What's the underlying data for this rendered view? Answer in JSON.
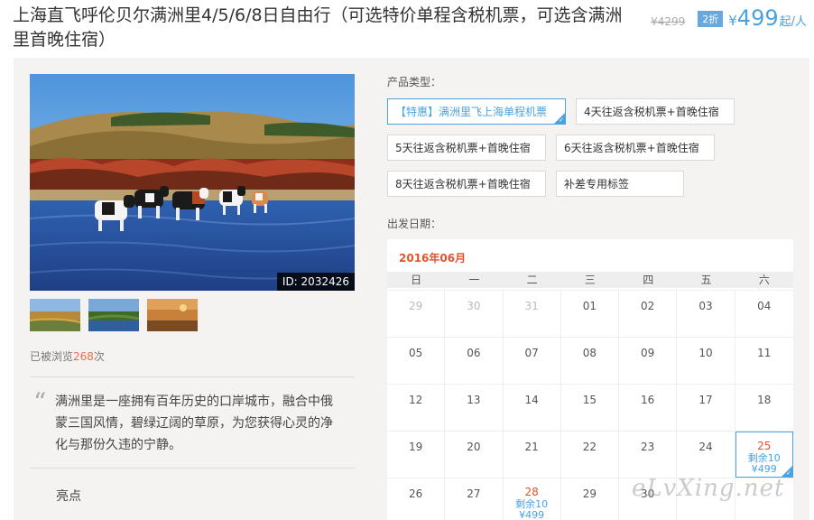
{
  "product": {
    "title": "上海直飞呼伦贝尔满洲里4/5/6/8日自由行（可选特价单程含税机票，可选含满洲里首晚住宿）",
    "old_price": "¥4299",
    "discount": "2折",
    "price_symbol": "¥",
    "price": "499",
    "price_unit": "起/人"
  },
  "gallery": {
    "image_id": "ID: 2032426",
    "views_prefix": "已被浏览",
    "views_count": "268",
    "views_suffix": "次"
  },
  "description": {
    "quote": "“",
    "text": "满洲里是一座拥有百年历史的口岸城市，融合中俄蒙三国风情，碧绿辽阔的草原，为您获得心灵的净化与那份久违的宁静。",
    "highlights_title": "亮点"
  },
  "options": {
    "product_type_label": "产品类型：",
    "product_types": [
      "【特惠】满洲里飞上海单程机票",
      "4天往返含税机票+首晚住宿",
      "5天往返含税机票+首晚住宿",
      "6天往返含税机票+首晚住宿",
      "8天往返含税机票+首晚住宿",
      "补差专用标签"
    ],
    "selected_type_index": 0,
    "departure_label": "出发日期："
  },
  "calendar": {
    "month": "2016年06月",
    "weekdays": [
      "日",
      "一",
      "二",
      "三",
      "四",
      "五",
      "六"
    ],
    "rows": [
      [
        {
          "d": "29",
          "m": true
        },
        {
          "d": "30",
          "m": true
        },
        {
          "d": "31",
          "m": true
        },
        {
          "d": "01"
        },
        {
          "d": "02"
        },
        {
          "d": "03"
        },
        {
          "d": "04"
        }
      ],
      [
        {
          "d": "05"
        },
        {
          "d": "06"
        },
        {
          "d": "07"
        },
        {
          "d": "08"
        },
        {
          "d": "09"
        },
        {
          "d": "10"
        },
        {
          "d": "11"
        }
      ],
      [
        {
          "d": "12"
        },
        {
          "d": "13"
        },
        {
          "d": "14"
        },
        {
          "d": "15"
        },
        {
          "d": "16"
        },
        {
          "d": "17"
        },
        {
          "d": "18"
        }
      ],
      [
        {
          "d": "19"
        },
        {
          "d": "20"
        },
        {
          "d": "21"
        },
        {
          "d": "22"
        },
        {
          "d": "23"
        },
        {
          "d": "24"
        },
        {
          "d": "25",
          "avail": true,
          "selected": true,
          "stock": "剩余10",
          "price": "¥499"
        }
      ],
      [
        {
          "d": "26"
        },
        {
          "d": "27"
        },
        {
          "d": "28",
          "avail": true,
          "stock": "剩余10",
          "price": "¥499"
        },
        {
          "d": "29"
        },
        {
          "d": "30"
        },
        {
          "d": ""
        },
        {
          "d": ""
        }
      ]
    ]
  },
  "watermark": "eLvXing.net",
  "colors": {
    "accent": "#4aa3df",
    "highlight": "#e0532c",
    "views": "#f06c3c",
    "panel_bg": "#f4f3f1"
  }
}
